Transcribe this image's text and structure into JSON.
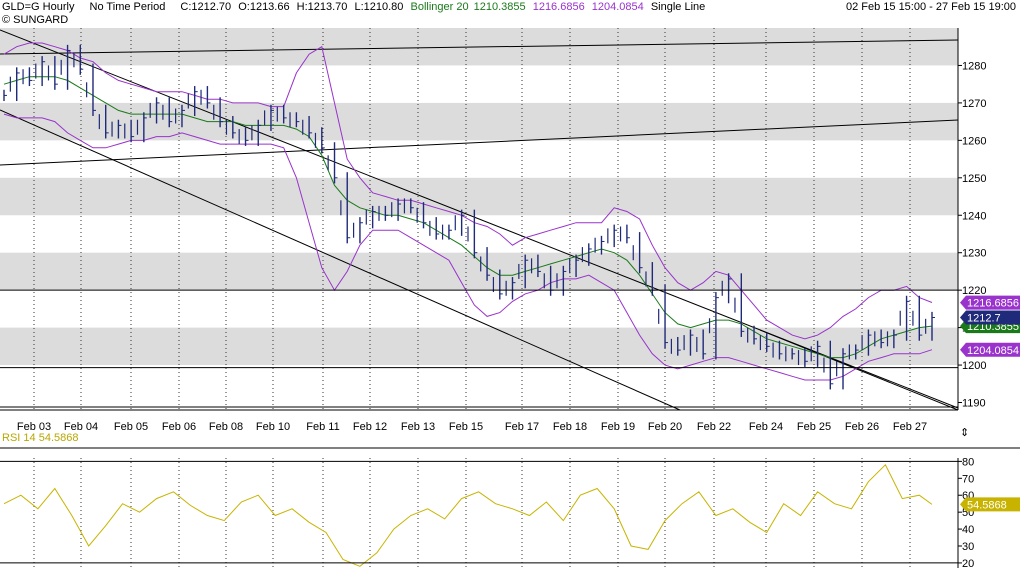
{
  "header": {
    "symbol": "GLD=G Hourly",
    "period": "No Time Period",
    "close": "C:1212.70",
    "open": "O:1213.66",
    "high": "H:1213.70",
    "low": "L:1210.80",
    "bollinger_label": "Bollinger 20",
    "bb_mid": "1210.3855",
    "bb_upper": "1216.6856",
    "bb_lower": "1204.0854",
    "line_mode": "Single Line",
    "source": "© SUNGARD",
    "date_range": "02 Feb 15 15:00  -  27 Feb 15 19:00"
  },
  "rsi": {
    "label": "RSI 14",
    "value": "54.5868"
  },
  "colors": {
    "price": "#1f2a7a",
    "bb_band": "#9933cc",
    "bb_mid": "#1a7a1a",
    "rsi": "#c8b400",
    "band_fill": "#dcdcdc",
    "trend": "#000000"
  },
  "chart_data": [
    {
      "type": "line",
      "title": "GLD=G Hourly",
      "ylim": [
        1188,
        1290
      ],
      "yticks": [
        1190,
        1200,
        1210,
        1220,
        1230,
        1240,
        1250,
        1260,
        1270,
        1280
      ],
      "xticks": [
        "Feb 03",
        "Feb 04",
        "Feb 05",
        "Feb 06",
        "Feb 08",
        "Feb 10",
        "Feb 11",
        "Feb 12",
        "Feb 13",
        "Feb 15",
        "Feb 17",
        "Feb 18",
        "Feb 19",
        "Feb 20",
        "Feb 22",
        "Feb 24",
        "Feb 25",
        "Feb 26",
        "Feb 27"
      ],
      "grid": true,
      "x_pos": [
        0,
        3,
        6,
        9,
        12,
        15,
        18,
        21,
        24,
        27,
        30,
        33,
        36,
        39,
        42,
        45,
        48,
        51,
        54,
        57,
        60,
        63,
        66,
        69,
        72,
        75,
        78,
        81,
        84,
        87,
        90,
        93,
        96,
        99,
        102,
        105,
        108,
        111,
        114,
        117,
        120,
        123,
        126,
        129,
        132,
        135,
        138,
        141,
        144,
        147,
        150,
        153,
        156,
        159,
        162,
        165,
        168,
        171,
        174,
        177,
        180,
        183,
        186,
        189,
        192,
        195,
        198,
        201,
        204,
        207,
        210,
        213,
        216,
        219
      ],
      "series": [
        {
          "name": "Close",
          "values": [
            1272,
            1278,
            1276,
            1281,
            1275,
            1284,
            1279,
            1268,
            1262,
            1264,
            1261,
            1266,
            1270,
            1265,
            1268,
            1273,
            1270,
            1265,
            1262,
            1260,
            1264,
            1268,
            1266,
            1265,
            1262,
            1258,
            1250,
            1234,
            1238,
            1241,
            1240,
            1243,
            1242,
            1238,
            1235,
            1236,
            1240,
            1230,
            1224,
            1219,
            1222,
            1228,
            1225,
            1220,
            1225,
            1228,
            1231,
            1233,
            1236,
            1234,
            1226,
            1220,
            1206,
            1204,
            1208,
            1203,
            1218,
            1223,
            1209,
            1207,
            1205,
            1203,
            1203,
            1201,
            1205,
            1195,
            1203,
            1204,
            1208,
            1206,
            1208,
            1217,
            1208,
            1212.7
          ]
        },
        {
          "name": "Bollinger 20",
          "values": [
            1275,
            1276,
            1277,
            1277,
            1277,
            1276,
            1274,
            1272,
            1270,
            1268,
            1267,
            1267,
            1267,
            1267,
            1267,
            1266,
            1265,
            1265,
            1265,
            1264,
            1264,
            1264,
            1264,
            1263,
            1261,
            1256,
            1248,
            1244,
            1242,
            1241,
            1240,
            1240,
            1239,
            1238,
            1236,
            1234,
            1232,
            1229,
            1226,
            1224,
            1224,
            1225,
            1226,
            1227,
            1228,
            1229,
            1230,
            1231,
            1230,
            1228,
            1224,
            1219,
            1214,
            1211,
            1210,
            1211,
            1212,
            1212,
            1211,
            1209,
            1207,
            1206,
            1205,
            1204,
            1203,
            1202,
            1202,
            1203,
            1205,
            1207,
            1208,
            1209,
            1210,
            1210.4
          ]
        },
        {
          "name": "Upper",
          "values": [
            1283,
            1285,
            1286,
            1286,
            1285,
            1284,
            1282,
            1281,
            1278,
            1276,
            1275,
            1274,
            1273,
            1273,
            1273,
            1272,
            1271,
            1271,
            1270,
            1270,
            1270,
            1269,
            1269,
            1278,
            1283,
            1285,
            1270,
            1255,
            1250,
            1246,
            1245,
            1244,
            1244,
            1243,
            1242,
            1241,
            1240,
            1238,
            1237,
            1235,
            1232,
            1234,
            1235,
            1236,
            1237,
            1238,
            1238,
            1238,
            1242,
            1241,
            1239,
            1232,
            1226,
            1222,
            1220,
            1222,
            1225,
            1224,
            1220,
            1216,
            1212,
            1210,
            1208,
            1207,
            1208,
            1210,
            1213,
            1215,
            1218,
            1220,
            1220,
            1221,
            1218,
            1216.7
          ]
        },
        {
          "name": "Lower",
          "values": [
            1267,
            1266,
            1266,
            1266,
            1265,
            1262,
            1260,
            1258,
            1258,
            1259,
            1260,
            1260,
            1261,
            1261,
            1262,
            1261,
            1260,
            1259,
            1259,
            1259,
            1259,
            1259,
            1258,
            1250,
            1238,
            1226,
            1220,
            1225,
            1232,
            1236,
            1236,
            1236,
            1234,
            1232,
            1230,
            1228,
            1222,
            1216,
            1213,
            1214,
            1217,
            1219,
            1220,
            1222,
            1223,
            1223,
            1224,
            1222,
            1220,
            1214,
            1208,
            1203,
            1200,
            1199,
            1200,
            1201,
            1202,
            1202,
            1201,
            1200,
            1199,
            1198,
            1197,
            1196,
            1196,
            1196,
            1197,
            1199,
            1201,
            1202,
            1203,
            1203,
            1203,
            1204.1
          ]
        }
      ]
    },
    {
      "type": "line",
      "title": "RSI 14",
      "ylim": [
        17,
        82
      ],
      "yticks": [
        20,
        30,
        40,
        50,
        60,
        70,
        80
      ],
      "x_pos": [
        0,
        4,
        8,
        12,
        16,
        20,
        24,
        28,
        32,
        36,
        40,
        44,
        48,
        52,
        56,
        60,
        64,
        68,
        72,
        76,
        80,
        84,
        88,
        92,
        96,
        100,
        104,
        108,
        112,
        116,
        120,
        124,
        128,
        132,
        136,
        140,
        144,
        148,
        152,
        156,
        160,
        164,
        168,
        172,
        176,
        180,
        184,
        188,
        192,
        196,
        200,
        204,
        208,
        212,
        216,
        219
      ],
      "series": [
        {
          "name": "RSI 14",
          "values": [
            55,
            60,
            52,
            64,
            48,
            30,
            42,
            55,
            50,
            58,
            62,
            54,
            48,
            45,
            56,
            60,
            48,
            52,
            44,
            38,
            22,
            18,
            26,
            40,
            48,
            52,
            46,
            58,
            62,
            55,
            52,
            48,
            56,
            45,
            60,
            64,
            52,
            30,
            28,
            45,
            55,
            62,
            48,
            52,
            44,
            38,
            55,
            48,
            62,
            55,
            52,
            68,
            78,
            58,
            60,
            54.6
          ]
        }
      ]
    }
  ]
}
